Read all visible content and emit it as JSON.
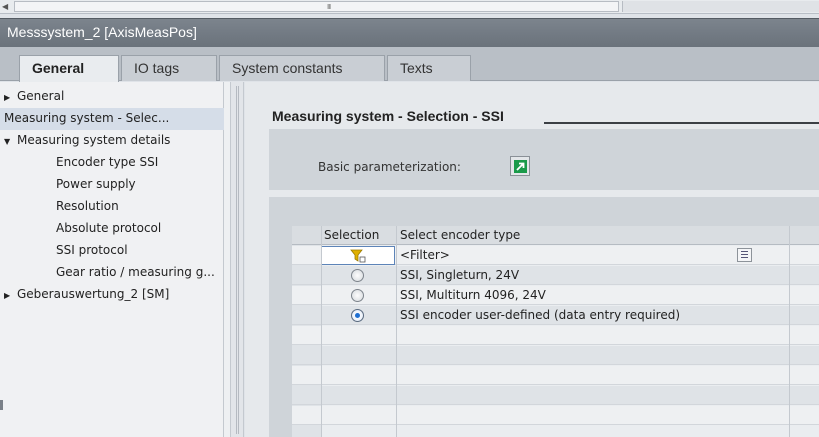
{
  "window": {
    "title": "Messsystem_2 [AxisMeasPos]"
  },
  "scrollbar": {
    "grip": "III"
  },
  "tabs": [
    {
      "label": "General",
      "active": true
    },
    {
      "label": "IO tags",
      "active": false
    },
    {
      "label": "System constants",
      "active": false
    },
    {
      "label": "Texts",
      "active": false
    }
  ],
  "nav": {
    "items": [
      {
        "label": "General",
        "expander": "collapsed"
      },
      {
        "label": "Measuring system - Selec...",
        "selected": true
      },
      {
        "label": "Measuring system details",
        "expander": "expanded"
      },
      {
        "label": "Encoder type SSI"
      },
      {
        "label": "Power supply"
      },
      {
        "label": "Resolution"
      },
      {
        "label": "Absolute protocol"
      },
      {
        "label": "SSI protocol"
      },
      {
        "label": "Gear ratio / measuring g..."
      },
      {
        "label": "Geberauswertung_2 [SM]",
        "expander": "collapsed"
      }
    ]
  },
  "main": {
    "section_title": "Measuring system - Selection - SSI",
    "basic_parameterization_label": "Basic parameterization:",
    "table": {
      "headers": [
        "Selection",
        "Select encoder type"
      ],
      "filter_text": "<Filter>",
      "rows": [
        {
          "label": "SSI, Singleturn, 24V",
          "selected": false
        },
        {
          "label": "SSI, Multiturn 4096, 24V",
          "selected": false
        },
        {
          "label": "SSI encoder user-defined (data entry required)",
          "selected": true
        }
      ]
    }
  },
  "colors": {
    "title_bar": "#6e767f",
    "selected_nav": "#d5dde8",
    "launch_icon": "#1a9a4a",
    "radio_checked": "#1f6fd1",
    "filter_icon": "#e0b000"
  }
}
